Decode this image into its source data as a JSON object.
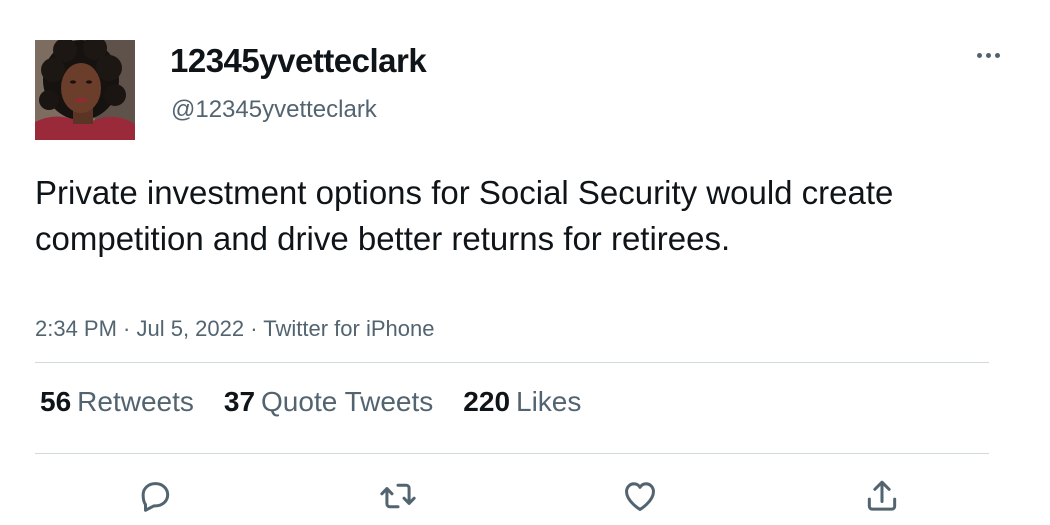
{
  "user": {
    "display_name": "12345yvetteclark",
    "handle": "@12345yvetteclark"
  },
  "tweet": {
    "text": "Private investment options for Social Security would create competition and drive better returns for retirees.",
    "meta": "2:34 PM · Jul 5, 2022 · Twitter for iPhone"
  },
  "stats": {
    "retweets": {
      "count": "56",
      "label": "Retweets"
    },
    "quotes": {
      "count": "37",
      "label": "Quote Tweets"
    },
    "likes": {
      "count": "220",
      "label": "Likes"
    }
  },
  "icons": {
    "more": "more-horizontal-icon",
    "reply": "reply-icon",
    "retweet": "retweet-icon",
    "like": "heart-icon",
    "share": "share-icon"
  },
  "colors": {
    "text_primary": "#0f1419",
    "text_secondary": "#536471",
    "divider": "#cfd9de"
  }
}
